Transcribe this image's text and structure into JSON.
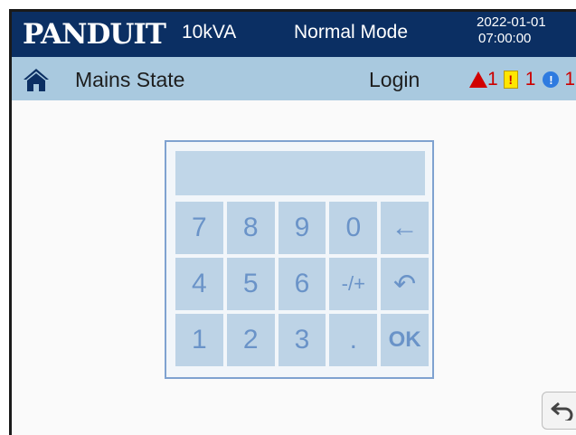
{
  "header": {
    "logo_text": "PANDUIT",
    "capacity": "10kVA",
    "mode": "Normal Mode",
    "date": "2022-01-01",
    "time": "07:00:00"
  },
  "subheader": {
    "home_icon": "home-icon",
    "state_label": "Mains State",
    "login_label": "Login",
    "alarms": {
      "critical_count": "1",
      "warning_count": "1",
      "info_count": "1",
      "critical_icon": "red-triangle-alarm-icon",
      "warning_icon": "yellow-exclamation-icon",
      "info_icon": "blue-info-icon"
    }
  },
  "keypad": {
    "display_value": "",
    "keys": [
      {
        "label": "7",
        "name": "key-7"
      },
      {
        "label": "8",
        "name": "key-8"
      },
      {
        "label": "9",
        "name": "key-9"
      },
      {
        "label": "0",
        "name": "key-0"
      },
      {
        "label": "←",
        "name": "key-backspace"
      },
      {
        "label": "4",
        "name": "key-4"
      },
      {
        "label": "5",
        "name": "key-5"
      },
      {
        "label": "6",
        "name": "key-6"
      },
      {
        "label": "-/+",
        "name": "key-sign"
      },
      {
        "label": "↶",
        "name": "key-undo"
      },
      {
        "label": "1",
        "name": "key-1"
      },
      {
        "label": "2",
        "name": "key-2"
      },
      {
        "label": "3",
        "name": "key-3"
      },
      {
        "label": ".",
        "name": "key-decimal"
      },
      {
        "label": "OK",
        "name": "key-ok"
      }
    ]
  },
  "footer": {
    "back_icon": "return-arrow-icon"
  },
  "colors": {
    "header_bg": "#0b2f63",
    "subheader_bg": "#a9c9df",
    "key_bg": "#bdd3e6",
    "key_text": "#6a93c8"
  }
}
